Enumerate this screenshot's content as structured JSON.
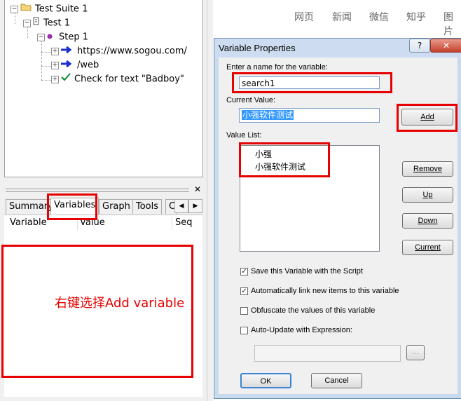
{
  "tree": {
    "suite": "Test Suite 1",
    "test": "Test 1",
    "step": "Step 1",
    "items": [
      "https://www.sogou.com/",
      "/web",
      "Check for text \"Badboy\""
    ]
  },
  "tabs": [
    "Summary",
    "Variables",
    "Graph",
    "Tools",
    "C"
  ],
  "columns": [
    "Variable",
    "Value",
    "Seq"
  ],
  "annotation": "右键选择Add variable",
  "browser_nav": [
    "网页",
    "新闻",
    "微信",
    "知乎",
    "图片"
  ],
  "dialog": {
    "title": "Variable Properties",
    "help_btn": "?",
    "close_btn": "✕",
    "name_label": "Enter a name for the variable:",
    "name_value": "search1",
    "current_label": "Current Value:",
    "current_value": "小强软件测试",
    "add_btn": "Add",
    "list_label": "Value List:",
    "list_items": [
      "小强",
      "小强软件测试"
    ],
    "remove_btn": "Remove",
    "up_btn": "Up",
    "down_btn": "Down",
    "current_btn": "Current",
    "options": [
      {
        "label": "Save this Variable with the Script",
        "checked": true
      },
      {
        "label": "Automatically link new items to this variable",
        "checked": true
      },
      {
        "label": "Obfuscate the values of this variable",
        "checked": false
      },
      {
        "label": "Auto-Update with Expression:",
        "checked": false
      }
    ],
    "browse_btn": "...",
    "ok_btn": "OK",
    "cancel_btn": "Cancel"
  },
  "colors": {
    "annotation": "#e60000",
    "selection": "#3399ff"
  }
}
